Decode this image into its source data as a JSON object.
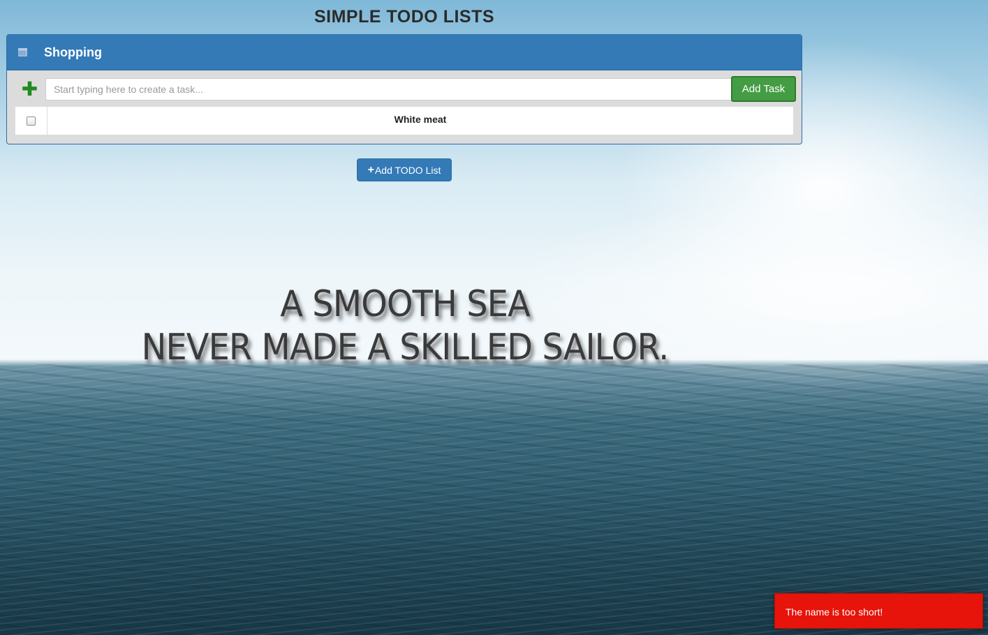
{
  "page": {
    "title": "SIMPLE TODO LISTS"
  },
  "list": {
    "name": "Shopping",
    "icon": "calendar-icon",
    "task_input": {
      "placeholder": "Start typing here to create a task...",
      "value": ""
    },
    "add_task_label": "Add Task",
    "tasks": [
      {
        "name": "White meat",
        "done": false
      }
    ]
  },
  "add_list_button": {
    "icon": "+",
    "label": "Add TODO List"
  },
  "background_quote": {
    "line1": "A SMOOTH SEA",
    "line2": "NEVER MADE A SKILLED SAILOR."
  },
  "toast": {
    "message": "The name is too short!",
    "color": "#e6140b"
  },
  "colors": {
    "primary": "#337ab7",
    "success": "#449d44"
  }
}
